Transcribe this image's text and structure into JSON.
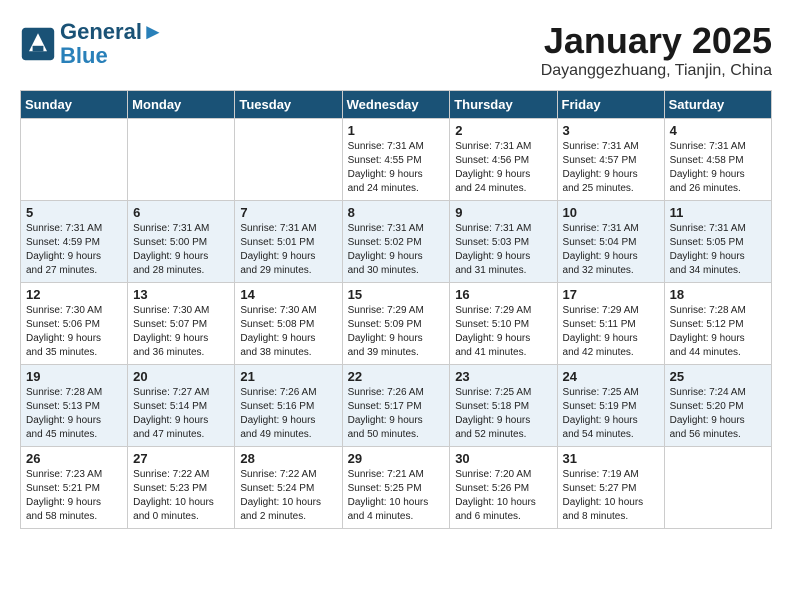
{
  "logo": {
    "line1": "General",
    "line2": "Blue"
  },
  "title": "January 2025",
  "subtitle": "Dayanggezhuang, Tianjin, China",
  "weekdays": [
    "Sunday",
    "Monday",
    "Tuesday",
    "Wednesday",
    "Thursday",
    "Friday",
    "Saturday"
  ],
  "weeks": [
    [
      {
        "day": "",
        "info": ""
      },
      {
        "day": "",
        "info": ""
      },
      {
        "day": "",
        "info": ""
      },
      {
        "day": "1",
        "info": "Sunrise: 7:31 AM\nSunset: 4:55 PM\nDaylight: 9 hours\nand 24 minutes."
      },
      {
        "day": "2",
        "info": "Sunrise: 7:31 AM\nSunset: 4:56 PM\nDaylight: 9 hours\nand 24 minutes."
      },
      {
        "day": "3",
        "info": "Sunrise: 7:31 AM\nSunset: 4:57 PM\nDaylight: 9 hours\nand 25 minutes."
      },
      {
        "day": "4",
        "info": "Sunrise: 7:31 AM\nSunset: 4:58 PM\nDaylight: 9 hours\nand 26 minutes."
      }
    ],
    [
      {
        "day": "5",
        "info": "Sunrise: 7:31 AM\nSunset: 4:59 PM\nDaylight: 9 hours\nand 27 minutes."
      },
      {
        "day": "6",
        "info": "Sunrise: 7:31 AM\nSunset: 5:00 PM\nDaylight: 9 hours\nand 28 minutes."
      },
      {
        "day": "7",
        "info": "Sunrise: 7:31 AM\nSunset: 5:01 PM\nDaylight: 9 hours\nand 29 minutes."
      },
      {
        "day": "8",
        "info": "Sunrise: 7:31 AM\nSunset: 5:02 PM\nDaylight: 9 hours\nand 30 minutes."
      },
      {
        "day": "9",
        "info": "Sunrise: 7:31 AM\nSunset: 5:03 PM\nDaylight: 9 hours\nand 31 minutes."
      },
      {
        "day": "10",
        "info": "Sunrise: 7:31 AM\nSunset: 5:04 PM\nDaylight: 9 hours\nand 32 minutes."
      },
      {
        "day": "11",
        "info": "Sunrise: 7:31 AM\nSunset: 5:05 PM\nDaylight: 9 hours\nand 34 minutes."
      }
    ],
    [
      {
        "day": "12",
        "info": "Sunrise: 7:30 AM\nSunset: 5:06 PM\nDaylight: 9 hours\nand 35 minutes."
      },
      {
        "day": "13",
        "info": "Sunrise: 7:30 AM\nSunset: 5:07 PM\nDaylight: 9 hours\nand 36 minutes."
      },
      {
        "day": "14",
        "info": "Sunrise: 7:30 AM\nSunset: 5:08 PM\nDaylight: 9 hours\nand 38 minutes."
      },
      {
        "day": "15",
        "info": "Sunrise: 7:29 AM\nSunset: 5:09 PM\nDaylight: 9 hours\nand 39 minutes."
      },
      {
        "day": "16",
        "info": "Sunrise: 7:29 AM\nSunset: 5:10 PM\nDaylight: 9 hours\nand 41 minutes."
      },
      {
        "day": "17",
        "info": "Sunrise: 7:29 AM\nSunset: 5:11 PM\nDaylight: 9 hours\nand 42 minutes."
      },
      {
        "day": "18",
        "info": "Sunrise: 7:28 AM\nSunset: 5:12 PM\nDaylight: 9 hours\nand 44 minutes."
      }
    ],
    [
      {
        "day": "19",
        "info": "Sunrise: 7:28 AM\nSunset: 5:13 PM\nDaylight: 9 hours\nand 45 minutes."
      },
      {
        "day": "20",
        "info": "Sunrise: 7:27 AM\nSunset: 5:14 PM\nDaylight: 9 hours\nand 47 minutes."
      },
      {
        "day": "21",
        "info": "Sunrise: 7:26 AM\nSunset: 5:16 PM\nDaylight: 9 hours\nand 49 minutes."
      },
      {
        "day": "22",
        "info": "Sunrise: 7:26 AM\nSunset: 5:17 PM\nDaylight: 9 hours\nand 50 minutes."
      },
      {
        "day": "23",
        "info": "Sunrise: 7:25 AM\nSunset: 5:18 PM\nDaylight: 9 hours\nand 52 minutes."
      },
      {
        "day": "24",
        "info": "Sunrise: 7:25 AM\nSunset: 5:19 PM\nDaylight: 9 hours\nand 54 minutes."
      },
      {
        "day": "25",
        "info": "Sunrise: 7:24 AM\nSunset: 5:20 PM\nDaylight: 9 hours\nand 56 minutes."
      }
    ],
    [
      {
        "day": "26",
        "info": "Sunrise: 7:23 AM\nSunset: 5:21 PM\nDaylight: 9 hours\nand 58 minutes."
      },
      {
        "day": "27",
        "info": "Sunrise: 7:22 AM\nSunset: 5:23 PM\nDaylight: 10 hours\nand 0 minutes."
      },
      {
        "day": "28",
        "info": "Sunrise: 7:22 AM\nSunset: 5:24 PM\nDaylight: 10 hours\nand 2 minutes."
      },
      {
        "day": "29",
        "info": "Sunrise: 7:21 AM\nSunset: 5:25 PM\nDaylight: 10 hours\nand 4 minutes."
      },
      {
        "day": "30",
        "info": "Sunrise: 7:20 AM\nSunset: 5:26 PM\nDaylight: 10 hours\nand 6 minutes."
      },
      {
        "day": "31",
        "info": "Sunrise: 7:19 AM\nSunset: 5:27 PM\nDaylight: 10 hours\nand 8 minutes."
      },
      {
        "day": "",
        "info": ""
      }
    ]
  ]
}
